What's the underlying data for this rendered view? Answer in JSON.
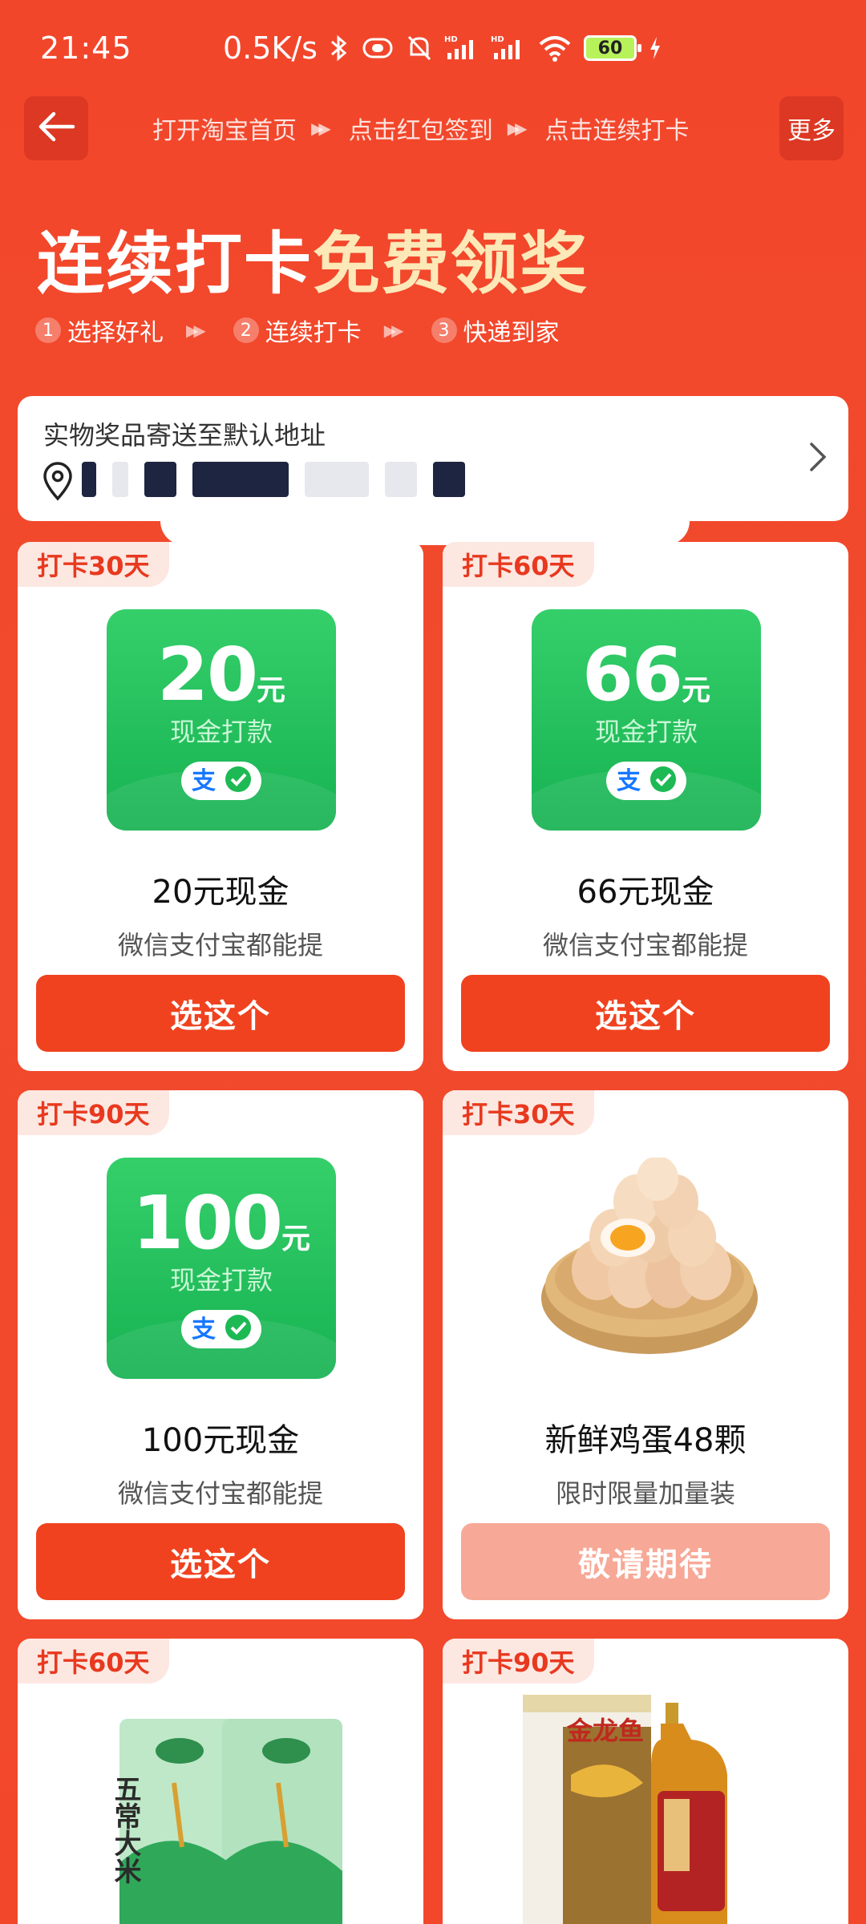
{
  "status_bar": {
    "time": "21:45",
    "speed": "0.5K/s",
    "battery": "60"
  },
  "nav": {
    "steps": [
      "打开淘宝首页",
      "点击红包签到",
      "点击连续打卡"
    ],
    "more_label": "更多"
  },
  "hero": {
    "title_part1": "连续打卡",
    "title_part2": "免费领奖",
    "steps": [
      {
        "num": "1",
        "label": "选择好礼"
      },
      {
        "num": "2",
        "label": "连续打卡"
      },
      {
        "num": "3",
        "label": "快递到家"
      }
    ]
  },
  "address": {
    "label": "实物奖品寄送至默认地址"
  },
  "cards": [
    {
      "tag": "打卡30天",
      "amount": "20",
      "unit": "元",
      "tile_sub": "现金打款",
      "title": "20元现金",
      "subtitle": "微信支付宝都能提",
      "button": "选这个"
    },
    {
      "tag": "打卡60天",
      "amount": "66",
      "unit": "元",
      "tile_sub": "现金打款",
      "title": "66元现金",
      "subtitle": "微信支付宝都能提",
      "button": "选这个"
    },
    {
      "tag": "打卡90天",
      "amount": "100",
      "unit": "元",
      "tile_sub": "现金打款",
      "title": "100元现金",
      "subtitle": "微信支付宝都能提",
      "button": "选这个"
    },
    {
      "tag": "打卡30天",
      "title": "新鲜鸡蛋48颗",
      "subtitle": "限时限量加量装",
      "button": "敬请期待"
    },
    {
      "tag": "打卡60天",
      "product_text": "五常大米"
    },
    {
      "tag": "打卡90天",
      "product_text": "金龙鱼"
    }
  ],
  "pay_icons": [
    "alipay-icon",
    "wechat-icon"
  ],
  "colors": {
    "background": "#f2462b",
    "accent": "#f0421f",
    "cash_green": "#1fb85a",
    "tag_bg": "#fde7e1",
    "disabled_button": "#f7a896"
  }
}
